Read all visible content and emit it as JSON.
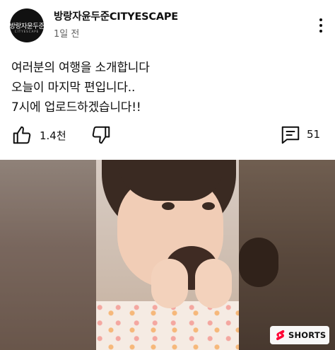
{
  "channel": {
    "avatar_text": "방랑자윤두준",
    "avatar_subtext": "CITYESCAPE",
    "name": "방랑자윤두준CITYESCAPE",
    "time": "1일 전"
  },
  "post": {
    "lines": [
      "여러분의 여행을 소개합니다",
      "오늘이 마지막 편입니다..",
      "7시에 업로드하겠습니다!!"
    ]
  },
  "actions": {
    "like_count": "1.4천",
    "comment_count": "51"
  },
  "shorts": {
    "badge_label": "SHORTS"
  },
  "icons": [
    "more-vert-icon",
    "thumbs-up-icon",
    "thumbs-down-icon",
    "comment-icon",
    "shorts-icon"
  ],
  "colors": {
    "shorts_red": "#ff0033",
    "text": "#0f0f0f",
    "secondary_text": "#606060"
  }
}
